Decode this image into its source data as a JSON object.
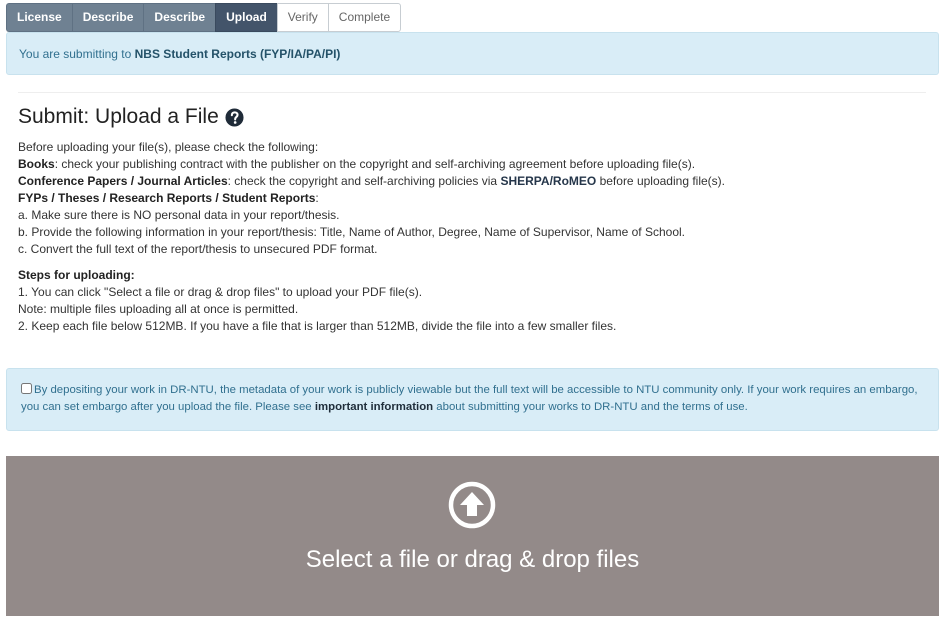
{
  "steps": [
    {
      "label": "License",
      "state": "done"
    },
    {
      "label": "Describe",
      "state": "done"
    },
    {
      "label": "Describe",
      "state": "done"
    },
    {
      "label": "Upload",
      "state": "current"
    },
    {
      "label": "Verify",
      "state": "todo"
    },
    {
      "label": "Complete",
      "state": "todo"
    }
  ],
  "submitting": {
    "prefix": "You are submitting to ",
    "collection": "NBS Student Reports (FYP/IA/PA/PI)"
  },
  "page_title": "Submit: Upload a File",
  "help_icon": "question-circle-icon",
  "instructions": {
    "intro": "Before uploading your file(s), please check the following:",
    "books_label": "Books",
    "books_text": ": check your publishing contract with the publisher on the copyright and self-archiving agreement before uploading file(s).",
    "conf_label": "Conference Papers / Journal Articles",
    "conf_text_before": ": check the copyright and self-archiving policies via ",
    "conf_link": "SHERPA/RoMEO",
    "conf_text_after": " before uploading file(s).",
    "fyp_label": "FYPs / Theses / Research Reports / Student Reports",
    "fyp_colon": ":",
    "item_a": "a. Make sure there is NO personal data in your report/thesis.",
    "item_b": "b. Provide the following information in your report/thesis: Title, Name of Author, Degree, Name of Supervisor, Name of School.",
    "item_c": "c. Convert the full text of the report/thesis to unsecured PDF format."
  },
  "steps_upload": {
    "heading": "Steps for uploading:",
    "step1": "1. You can click \"Select a file or drag & drop files\" to upload your PDF file(s).",
    "note": "Note: multiple files uploading all at once is permitted.",
    "step2": "2. Keep each file below 512MB. If you have a file that is larger than 512MB, divide the file into a few smaller files."
  },
  "consent": {
    "checked": false,
    "text_before": "By depositing your work in DR-NTU, the metadata of your work is publicly viewable but the full text will be accessible to NTU community only. If your work requires an embargo, you can set embargo after you upload the file. Please see ",
    "link": "important information",
    "text_after": " about submitting your works to DR-NTU and the terms of use."
  },
  "dropzone": {
    "icon": "upload-arrow-circle-icon",
    "label": "Select a file or drag & drop files",
    "background": "#938a89"
  },
  "colors": {
    "step_done": "#6f8192",
    "step_current": "#43546a",
    "alert_bg": "#d9edf7",
    "alert_text": "#31708f"
  }
}
